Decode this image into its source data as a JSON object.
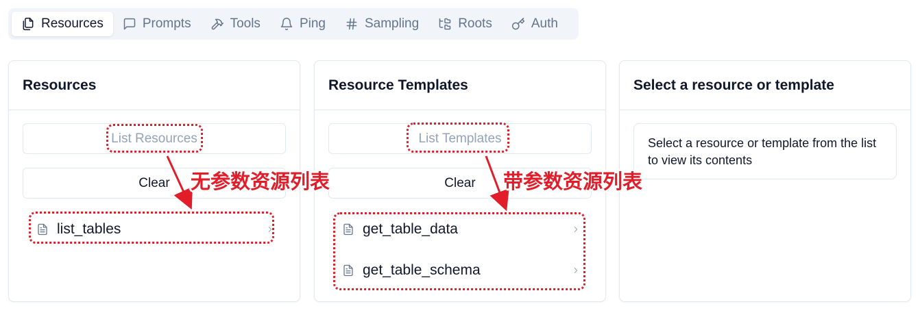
{
  "tabs": [
    {
      "label": "Resources",
      "icon": "files-icon",
      "active": true
    },
    {
      "label": "Prompts",
      "icon": "message-square-icon",
      "active": false
    },
    {
      "label": "Tools",
      "icon": "hammer-icon",
      "active": false
    },
    {
      "label": "Ping",
      "icon": "bell-icon",
      "active": false
    },
    {
      "label": "Sampling",
      "icon": "hash-icon",
      "active": false
    },
    {
      "label": "Roots",
      "icon": "folder-tree-icon",
      "active": false
    },
    {
      "label": "Auth",
      "icon": "key-icon",
      "active": false
    }
  ],
  "resources_panel": {
    "title": "Resources",
    "list_button": "List Resources",
    "clear_button": "Clear",
    "items": [
      "list_tables"
    ]
  },
  "templates_panel": {
    "title": "Resource Templates",
    "list_button": "List Templates",
    "clear_button": "Clear",
    "items": [
      "get_table_data",
      "get_table_schema"
    ]
  },
  "detail_panel": {
    "title": "Select a resource or template",
    "message": "Select a resource or template from the list to view its contents"
  },
  "annotations": {
    "resources_note": "无参数资源列表",
    "templates_note": "带参数资源列表",
    "color": "#e11d2a"
  }
}
